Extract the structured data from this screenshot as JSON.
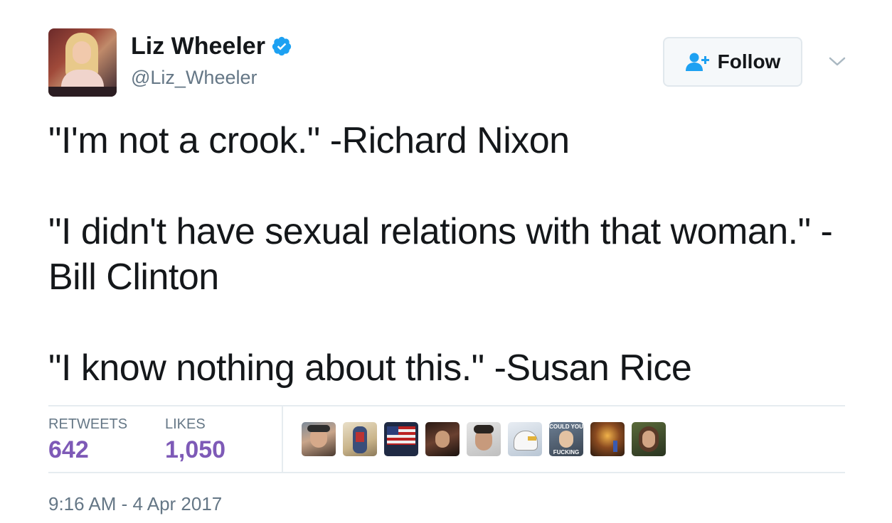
{
  "author": {
    "name": "Liz Wheeler",
    "handle": "@Liz_Wheeler",
    "verified": true
  },
  "follow_button": {
    "label": "Follow",
    "icon": "add-user-icon"
  },
  "menu_icon": "chevron-down-icon",
  "tweet": {
    "paragraphs": [
      "\"I'm not a crook.\" -Richard Nixon",
      "\"I didn't have sexual relations with that woman.\" - Bill Clinton",
      "\"I know nothing about this.\" -Susan Rice"
    ]
  },
  "stats": {
    "retweets_label": "RETWEETS",
    "retweets_value": "642",
    "likes_label": "LIKES",
    "likes_value": "1,050"
  },
  "likers": [
    {
      "name": "liker-avatar-1",
      "overlay_top": "",
      "overlay_bottom": ""
    },
    {
      "name": "liker-avatar-2",
      "overlay_top": "",
      "overlay_bottom": ""
    },
    {
      "name": "liker-avatar-3",
      "overlay_top": "",
      "overlay_bottom": ""
    },
    {
      "name": "liker-avatar-4",
      "overlay_top": "",
      "overlay_bottom": ""
    },
    {
      "name": "liker-avatar-5",
      "overlay_top": "",
      "overlay_bottom": ""
    },
    {
      "name": "liker-avatar-6",
      "overlay_top": "",
      "overlay_bottom": ""
    },
    {
      "name": "liker-avatar-7",
      "overlay_top": "COULD YOU",
      "overlay_bottom": "FUCKING NOT"
    },
    {
      "name": "liker-avatar-8",
      "overlay_top": "",
      "overlay_bottom": ""
    },
    {
      "name": "liker-avatar-9",
      "overlay_top": "",
      "overlay_bottom": ""
    }
  ],
  "timestamp": "9:16 AM - 4 Apr 2017",
  "colors": {
    "verified_blue": "#1da1f2",
    "stat_purple": "#7e5ab7",
    "secondary_text": "#657786",
    "divider": "#e6ecf0"
  }
}
